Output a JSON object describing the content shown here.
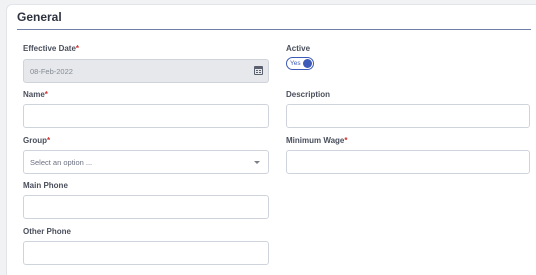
{
  "section": {
    "title": "General"
  },
  "fields": {
    "effective_date": {
      "label": "Effective Date",
      "required_mark": "*",
      "value": "08-Feb-2022"
    },
    "active": {
      "label": "Active",
      "toggle_text": "Yes",
      "state": "on"
    },
    "name": {
      "label": "Name",
      "required_mark": "*",
      "value": ""
    },
    "description": {
      "label": "Description",
      "value": ""
    },
    "group": {
      "label": "Group",
      "required_mark": "*",
      "placeholder": "Select an option ..."
    },
    "minimum_wage": {
      "label": "Minimum Wage",
      "required_mark": "*",
      "value": ""
    },
    "main_phone": {
      "label": "Main Phone",
      "value": ""
    },
    "other_phone": {
      "label": "Other Phone",
      "value": ""
    }
  },
  "colors": {
    "accent": "#3d5ab8",
    "required": "#d0312d",
    "rule": "#6f7fa8"
  },
  "icons": {
    "date_picker": "calendar-icon",
    "select": "chevron-down-icon"
  }
}
